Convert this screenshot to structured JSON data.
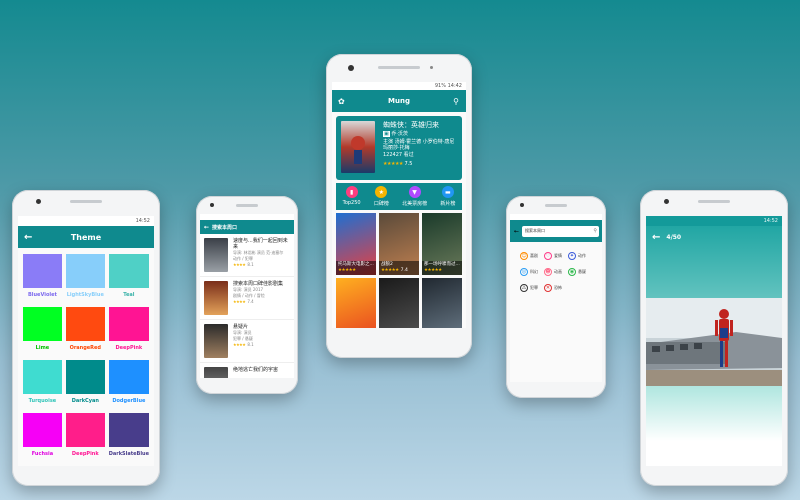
{
  "colors": {
    "accent": "#0f8a8e",
    "star": "#f4b400"
  },
  "theme_phone": {
    "status": "14:52",
    "title": "Theme",
    "themes": [
      {
        "name": "BlueViolet",
        "color": "#8a7cf7",
        "label_color": "#7b68ee"
      },
      {
        "name": "LightSkyBlue",
        "color": "#87cefa",
        "label_color": "#87cefa"
      },
      {
        "name": "Teal",
        "color": "#4fd0c6",
        "label_color": "#38b2a8"
      },
      {
        "name": "Lime",
        "color": "#00ff22",
        "label_color": "#00c000"
      },
      {
        "name": "OrangeRed",
        "color": "#ff4a10",
        "label_color": "#ff4500"
      },
      {
        "name": "DeepPink",
        "color": "#ff1493",
        "label_color": "#ff1493"
      },
      {
        "name": "Turquoise",
        "color": "#3fdcd0",
        "label_color": "#2fc4b8"
      },
      {
        "name": "DarkCyan",
        "color": "#008b8b",
        "label_color": "#008b8b"
      },
      {
        "name": "DodgerBlue",
        "color": "#1e90ff",
        "label_color": "#1e90ff"
      },
      {
        "name": "Fuchsia",
        "color": "#f600f6",
        "label_color": "#e000e0"
      },
      {
        "name": "DeepPink",
        "color": "#ff1e8a",
        "label_color": "#ff1493"
      },
      {
        "name": "DarkSlateBlue",
        "color": "#483d8b",
        "label_color": "#483d8b"
      }
    ]
  },
  "list_phone": {
    "title": "搜索本周口",
    "items": [
      {
        "title": "速度与...我们一起回到未来",
        "line1": "导演: 林诣彬 演员 范·迪塞尔",
        "line2": "动作 / 犯罪",
        "rating": "8.1",
        "poster": [
          "#3a3f47",
          "#9aa0a6"
        ]
      },
      {
        "title": "搜索本周口碑佳影剧集",
        "line1": "导演: 演员 2017",
        "line2": "剧情 / 动作 / 冒险",
        "rating": "7.4",
        "poster": [
          "#7a2e1a",
          "#e3a25a"
        ]
      },
      {
        "title": "悬疑片",
        "line1": "导演: 演员",
        "line2": "犯罪 / 悬疑",
        "rating": "8.1",
        "poster": [
          "#2b2b2b",
          "#a08060"
        ]
      },
      {
        "title": "绝地逃亡我们的宇宙",
        "line1": "",
        "line2": "",
        "rating": "",
        "poster": [
          "#444",
          "#999"
        ]
      }
    ]
  },
  "main_phone": {
    "status": "91% 14:42",
    "title": "Mung",
    "feature": {
      "title": "蜘蛛侠：英雄归来",
      "director": "乔·沃茨",
      "cast": "主演 汤姆·霍兰德 小罗伯特·唐尼 玛丽莎·托梅",
      "count": "122427 看过",
      "rating": "7.5"
    },
    "tabs": [
      {
        "label": "Top250",
        "icon_color": "#ff3d7f",
        "glyph": "▮"
      },
      {
        "label": "口碑榜",
        "icon_color": "#f5b400",
        "glyph": "★"
      },
      {
        "label": "北美票房榜",
        "icon_color": "#b14bff",
        "glyph": "▼"
      },
      {
        "label": "新片榜",
        "icon_color": "#2196f3",
        "glyph": "▬"
      }
    ],
    "movies": [
      {
        "caption": "托马斯大电影之...",
        "rating": "",
        "colors": [
          "#1f6fd1",
          "#e84040"
        ]
      },
      {
        "caption": "战狼2",
        "rating": "7.4",
        "colors": [
          "#5a4a3a",
          "#c08050"
        ]
      },
      {
        "caption": "那一场呼啸而过...",
        "rating": "",
        "colors": [
          "#1a3a2a",
          "#6a7a5a"
        ]
      },
      {
        "caption": "",
        "rating": "",
        "colors": [
          "#ffb020",
          "#e64020"
        ]
      },
      {
        "caption": "",
        "rating": "",
        "colors": [
          "#1a1a1a",
          "#555"
        ]
      },
      {
        "caption": "",
        "rating": "",
        "colors": [
          "#202830",
          "#6a7a88"
        ]
      }
    ]
  },
  "search_phone": {
    "query": "搜索本周口",
    "categories": [
      {
        "label": "喜剧",
        "color": "#ff8c00",
        "glyph": "☺"
      },
      {
        "label": "爱情",
        "color": "#ff3b8a",
        "glyph": "♡"
      },
      {
        "label": "动作",
        "color": "#3b5bdb",
        "glyph": "✦"
      },
      {
        "label": "科幻",
        "color": "#2a9df4",
        "glyph": "◎"
      },
      {
        "label": "动画",
        "color": "#ff6b8a",
        "glyph": "☻"
      },
      {
        "label": "悬疑",
        "color": "#2bb84a",
        "glyph": "◉"
      },
      {
        "label": "犯罪",
        "color": "#333333",
        "glyph": "⚠"
      },
      {
        "label": "恐怖",
        "color": "#e03131",
        "glyph": "✕"
      }
    ]
  },
  "photo_phone": {
    "status": "14:52",
    "counter": "4/50"
  }
}
